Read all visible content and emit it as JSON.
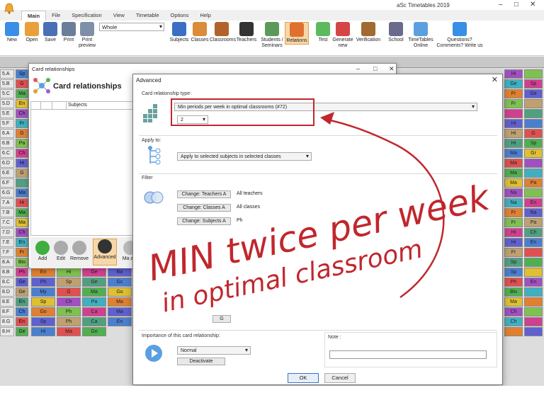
{
  "app": {
    "title": "aSc Timetables 2019",
    "min": "–",
    "max": "□",
    "close": "✕"
  },
  "menu": [
    "Main",
    "File",
    "Specification",
    "View",
    "Timetable",
    "Options",
    "Help"
  ],
  "ribbon": {
    "left": [
      {
        "label": "New",
        "color": "#3a8ee6"
      },
      {
        "label": "Open",
        "color": "#e9a03b"
      },
      {
        "label": "Save",
        "color": "#4b6fb5"
      },
      {
        "label": "Print",
        "color": "#6a7d99"
      },
      {
        "label": "Print preview",
        "color": "#7f8fa8"
      }
    ],
    "view_value": "Whole",
    "right": [
      {
        "label": "Subjects",
        "color": "#3b6fc4"
      },
      {
        "label": "Classes",
        "color": "#d98c3a"
      },
      {
        "label": "Classrooms",
        "color": "#b2632c"
      },
      {
        "label": "Teachers",
        "color": "#333333"
      },
      {
        "label": "Students / Seminars",
        "color": "#5b9a5b"
      },
      {
        "label": "Relations",
        "color": "#e07030"
      },
      {
        "label": "Test",
        "color": "#5cba5c"
      },
      {
        "label": "Generate new",
        "color": "#d64545"
      },
      {
        "label": "Verification",
        "color": "#a06a30"
      },
      {
        "label": "School",
        "color": "#6a6a8a"
      },
      {
        "label": "TimeTables Online",
        "color": "#5aa0e0"
      },
      {
        "label": "Questions? Comments? Write us",
        "color": "#3a8ee6"
      }
    ]
  },
  "grid": {
    "rows": [
      "5.A",
      "5.B",
      "5.C",
      "5.D",
      "5.E",
      "5.F",
      "6.A",
      "6.B",
      "6.C",
      "6.D",
      "6.E",
      "6.F",
      "6.G",
      "7.A",
      "7.B",
      "7.C",
      "7.D",
      "7.E",
      "7.F",
      "8.A",
      "8.B",
      "8.C",
      "8.D",
      "8.E",
      "8.F",
      "8.G",
      "8.H"
    ],
    "left_cells": [
      "Sp",
      "G",
      "Ma",
      "En",
      "Ch",
      "Fr",
      "G",
      "Pa",
      "Ch",
      "Hi",
      "G",
      "",
      "Ma",
      "Hi",
      "Ma",
      "Ma",
      "Ch",
      "En",
      "Fr",
      "Bio",
      "Ph",
      "Ge",
      "Ge",
      "En",
      "Ch",
      "En",
      "Ge"
    ],
    "right_cells": [
      "Hi",
      "Ge",
      "Fr",
      "Fr",
      "",
      "Hi",
      "Hi",
      "Hi",
      "Ma",
      "Ma",
      "Ma",
      "Ma",
      "Na",
      "Na",
      "Fr",
      "Fr",
      "Hi",
      "Hi",
      "Fr",
      "Sp",
      "Sp",
      "Ph",
      "Bio",
      "Ma",
      "Ch",
      "Ch",
      ""
    ],
    "right_cells2": [
      "",
      "Sp",
      "Ge",
      "",
      "",
      "",
      "G",
      "Sp",
      "Gr",
      "",
      "",
      "Pa",
      "",
      "En",
      "Na",
      "Pa",
      "Ch",
      "En",
      "",
      "",
      "",
      "En",
      "",
      "",
      "",
      "",
      ""
    ],
    "bottom_cells": [
      {
        "row": 18,
        "cells": [
          "Ch",
          "G",
          "Ph"
        ]
      },
      {
        "row": 19,
        "cells": [
          "Ma",
          "En",
          "Ge",
          "Sp"
        ]
      },
      {
        "row": 20,
        "cells": [
          "En",
          "Hi",
          "Ge",
          "Ba"
        ]
      },
      {
        "row": 21,
        "cells": [
          "Ph",
          "Sp",
          "Ge",
          "Gc"
        ]
      },
      {
        "row": 22,
        "cells": [
          "My",
          "G",
          "Ma",
          "Go"
        ]
      },
      {
        "row": 23,
        "cells": [
          "Sp",
          "Ch",
          "Pa",
          "Ma"
        ]
      },
      {
        "row": 24,
        "cells": [
          "Go",
          "Ph",
          "Ca",
          "Ma"
        ]
      },
      {
        "row": 25,
        "cells": [
          "Sp",
          "Ph",
          "Ca",
          "En"
        ]
      },
      {
        "row": 26,
        "cells": [
          "Hi",
          "Ma",
          "Go"
        ]
      }
    ]
  },
  "card_window": {
    "title": "Card relationships",
    "min": "–",
    "max": "□",
    "close": "✕",
    "heading": "Card relationships",
    "col_subjects": "Subjects",
    "buttons": [
      {
        "label": "Add",
        "color": "#3fae3f"
      },
      {
        "label": "Edit",
        "color": "#aaaaaa"
      },
      {
        "label": "Remove",
        "color": "#aaaaaa"
      },
      {
        "label": "Advanced",
        "color": "#333333"
      },
      {
        "label": "Ma acti",
        "color": "#bbbbbb"
      }
    ]
  },
  "advanced": {
    "title": "Advanced",
    "close": "✕",
    "type_label": "Card relationship type:",
    "type_value": "Min periods per week in optimal classrooms (#72)",
    "count_value": "2",
    "apply_label": "Apply to:",
    "apply_value": "Apply to selected subjects in selected classes",
    "filter_label": "Filter",
    "filters": [
      {
        "button": "Change: Teachers A",
        "value": "All teachers"
      },
      {
        "button": "Change: Classes A",
        "value": "All classes"
      },
      {
        "button": "Change: Subjects A",
        "value": "Ph"
      }
    ],
    "clear_label": "G",
    "importance_label": "Importance of this card relationship:",
    "importance_value": "Normal",
    "deactivate": "Deactivate",
    "note_label": "Note :",
    "note_value": "",
    "ok": "OK",
    "cancel": "Cancel"
  },
  "annotation": {
    "line1": "MIN twice per week",
    "line2": "in optimal classroom",
    "color": "#c0272d"
  }
}
